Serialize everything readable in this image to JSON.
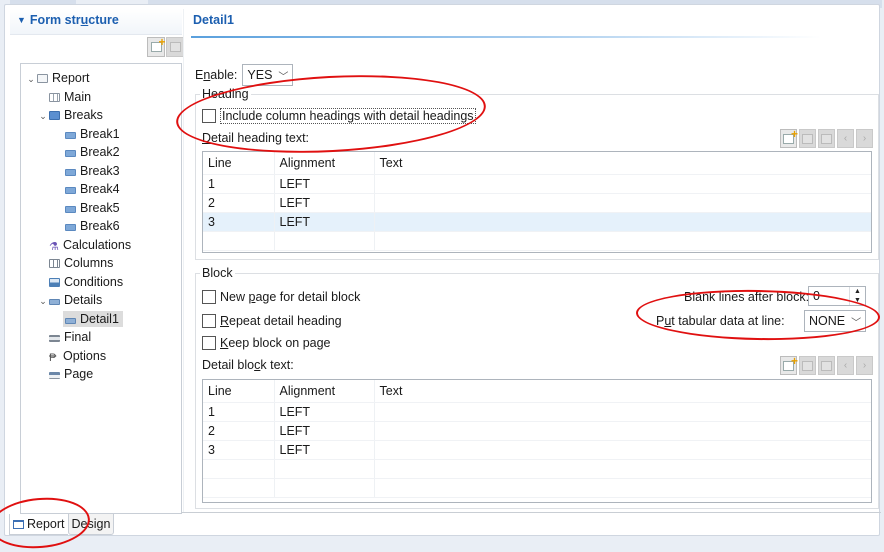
{
  "left_pane": {
    "title": "Form structure",
    "title_parts": {
      "pre": "Form str",
      "u": "u",
      "post": "cture"
    },
    "toolbar": [
      {
        "name": "add-icon",
        "enabled": true
      },
      {
        "name": "delete-icon",
        "enabled": false
      }
    ],
    "tree": [
      {
        "label": "Report",
        "icon": "report-icon",
        "level": 0,
        "expanded": true
      },
      {
        "label": "Main",
        "icon": "main-icon",
        "level": 1
      },
      {
        "label": "Breaks",
        "icon": "breaks-icon",
        "level": 1,
        "expanded": true
      },
      {
        "label": "Break1",
        "icon": "break-icon",
        "level": 2
      },
      {
        "label": "Break2",
        "icon": "break-icon",
        "level": 2
      },
      {
        "label": "Break3",
        "icon": "break-icon",
        "level": 2
      },
      {
        "label": "Break4",
        "icon": "break-icon",
        "level": 2
      },
      {
        "label": "Break5",
        "icon": "break-icon",
        "level": 2
      },
      {
        "label": "Break6",
        "icon": "break-icon",
        "level": 2
      },
      {
        "label": "Calculations",
        "icon": "calculations-icon",
        "level": 1
      },
      {
        "label": "Columns",
        "icon": "columns-icon",
        "level": 1
      },
      {
        "label": "Conditions",
        "icon": "conditions-icon",
        "level": 1
      },
      {
        "label": "Details",
        "icon": "details-icon",
        "level": 1,
        "expanded": true
      },
      {
        "label": "Detail1",
        "icon": "detail-icon",
        "level": 2,
        "selected": true
      },
      {
        "label": "Final",
        "icon": "final-icon",
        "level": 1
      },
      {
        "label": "Options",
        "icon": "options-icon",
        "level": 1
      },
      {
        "label": "Page",
        "icon": "page-icon",
        "level": 1
      }
    ]
  },
  "right_pane": {
    "title": "Detail1",
    "enable": {
      "label_pre": "E",
      "label_u": "n",
      "label_post": "able:",
      "value": "YES"
    },
    "heading_group": {
      "title": "Heading",
      "include_checkbox": {
        "label": "Include column headings with detail headings",
        "checked": false
      },
      "text_label": {
        "u": "D",
        "rest": "etail heading text:"
      },
      "columns": [
        "Line",
        "Alignment",
        "Text"
      ],
      "rows": [
        {
          "line": "1",
          "alignment": "LEFT",
          "text": ""
        },
        {
          "line": "2",
          "alignment": "LEFT",
          "text": ""
        },
        {
          "line": "3",
          "alignment": "LEFT",
          "text": ""
        }
      ],
      "highlighted_row": 2
    },
    "block_group": {
      "title": "Block",
      "new_page": {
        "pre": "New ",
        "u": "p",
        "post": "age for detail block",
        "checked": false
      },
      "repeat_heading": {
        "pre": "",
        "u": "R",
        "post": "epeat detail heading",
        "checked": false
      },
      "keep_block": {
        "pre": "",
        "u": "K",
        "post": "eep block on page",
        "checked": false
      },
      "blank_lines_label": "Blank lines after block:",
      "blank_lines_value": "0",
      "tabular_label": {
        "pre": "P",
        "u": "u",
        "post": "t tabular data at line:"
      },
      "tabular_value": "NONE",
      "text_label": {
        "pre": "Detail blo",
        "u": "c",
        "post": "k text:"
      },
      "columns": [
        "Line",
        "Alignment",
        "Text"
      ],
      "rows": [
        {
          "line": "1",
          "alignment": "LEFT",
          "text": ""
        },
        {
          "line": "2",
          "alignment": "LEFT",
          "text": ""
        },
        {
          "line": "3",
          "alignment": "LEFT",
          "text": ""
        }
      ]
    },
    "table_toolbar": [
      "add-icon",
      "edit-icon",
      "delete-icon",
      "move-up-icon",
      "move-down-icon"
    ]
  },
  "page_tabs": [
    {
      "label": "Report",
      "active": true
    },
    {
      "label": "Design",
      "active": false
    }
  ],
  "colors": {
    "accent": "#1c5fb0",
    "annotation": "#e01010",
    "row_highlight": "#e5f1fb"
  }
}
